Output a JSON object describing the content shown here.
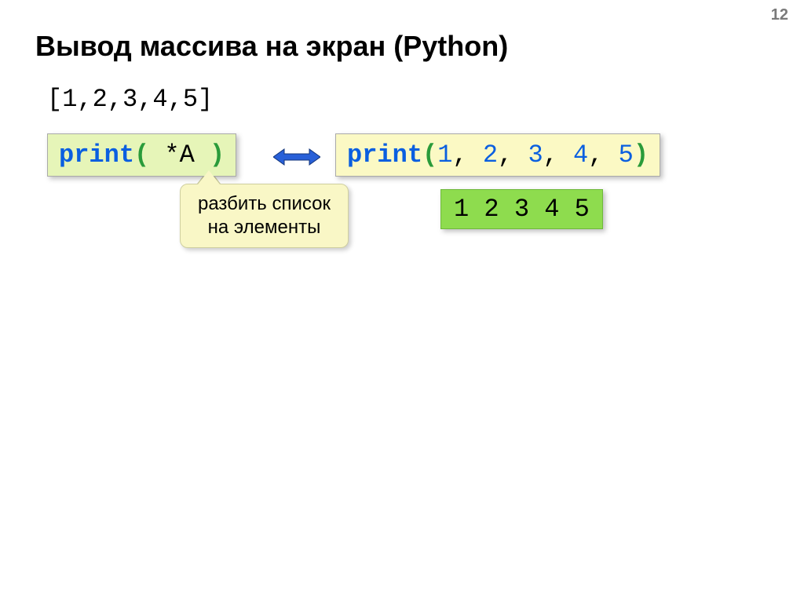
{
  "page_number": "12",
  "title": "Вывод массива на экран (Python)",
  "array_literal": "[1,2,3,4,5]",
  "code_left": {
    "keyword": "print",
    "open": "(",
    "body": " *A ",
    "close": ")"
  },
  "code_right": {
    "keyword": "print",
    "open": "(",
    "args": [
      "1",
      "2",
      "3",
      "4",
      "5"
    ],
    "sep": ", ",
    "close": ")"
  },
  "callout_line1": "разбить список",
  "callout_line2": "на элементы",
  "output": "1 2 3 4 5"
}
